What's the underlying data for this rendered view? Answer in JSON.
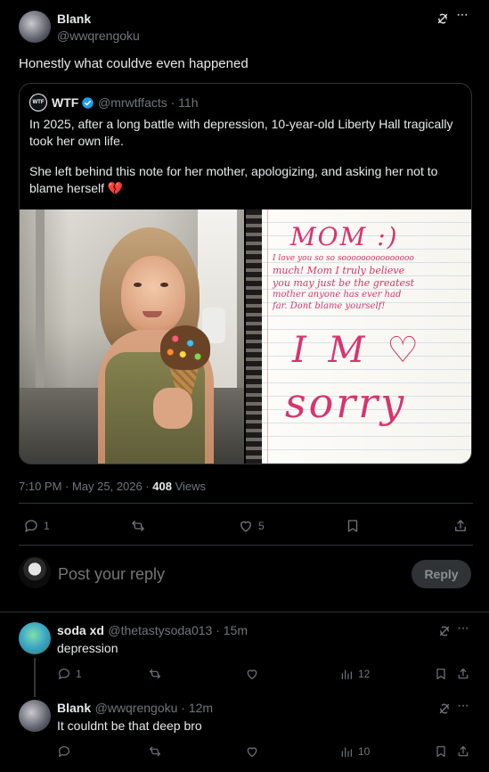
{
  "main_tweet": {
    "author_name": "Blank",
    "author_handle": "@wwqrengoku",
    "text": "Honestly what couldve even happened",
    "timestamp": "7:10 PM · May 25, 2026 · ",
    "views_count": "408",
    "views_label": " Views",
    "actions": {
      "replies": "1",
      "retweets": "",
      "likes": "5"
    }
  },
  "quoted_tweet": {
    "author_name": "WTF",
    "author_handle": "@mrwtffacts · 11h",
    "paragraph1": "In 2025, after a long battle with depression, 10-year-old Liberty Hall tragically took her own life.",
    "paragraph2": "She left behind this note for her mother, apologizing, and asking her not to blame herself 💔",
    "note_text": {
      "line1": "MOM :)",
      "line2": "I love you so so sooooooooooooooo",
      "line3": "much! Mom I truly believe",
      "line4": "you may just be the greatest",
      "line5": "mother anyone has ever had",
      "line6": "far. Dont blame yourself!",
      "line7": "I M ♡",
      "line8": "sorry"
    }
  },
  "reply_composer": {
    "placeholder": "Post your reply",
    "button_label": "Reply"
  },
  "replies": [
    {
      "author_name": "soda xd",
      "author_handle": "@thetastysoda013 · 15m",
      "text": "depression",
      "replies": "1",
      "retweets": "",
      "likes": "",
      "views": "12"
    },
    {
      "author_name": "Blank",
      "author_handle": "@wwqrengoku · 12m",
      "text": "It couldnt be that deep bro",
      "replies": "",
      "retweets": "",
      "likes": "",
      "views": "10"
    }
  ],
  "icons": [
    "grok-icon",
    "more-icon",
    "verified-icon",
    "reply-icon",
    "retweet-icon",
    "like-icon",
    "bookmark-icon",
    "share-icon",
    "views-icon"
  ],
  "colors": {
    "background": "#000000",
    "text": "#e7e9ea",
    "muted": "#71767b",
    "border": "#2f3336",
    "verified": "#1d9bf0",
    "note_ink": "#d8346e"
  }
}
